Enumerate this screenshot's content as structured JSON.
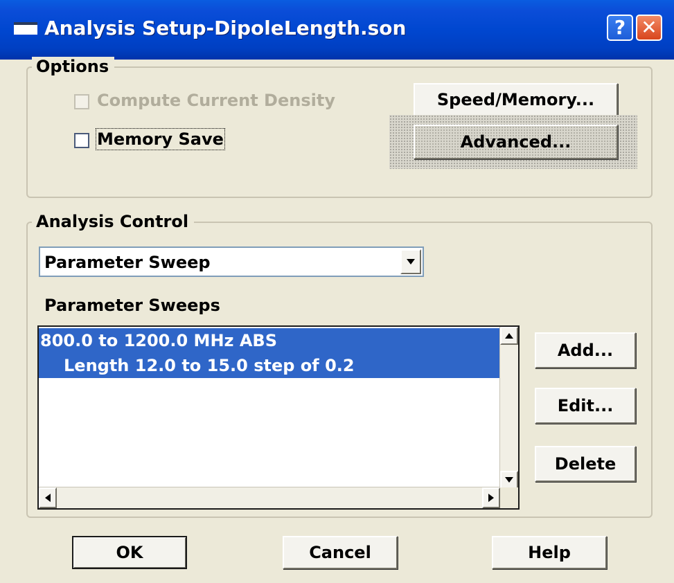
{
  "window": {
    "title": "Analysis Setup-DipoleLength.son"
  },
  "titlebar": {
    "help_glyph": "?",
    "close_glyph": "✕"
  },
  "options": {
    "group_label": "Options",
    "compute_current_density": {
      "label": "Compute Current Density",
      "checked": false,
      "enabled": false
    },
    "memory_save": {
      "label": "Memory Save",
      "checked": false,
      "enabled": true
    },
    "speed_memory_label": "Speed/Memory...",
    "advanced_label": "Advanced..."
  },
  "analysis_control": {
    "group_label": "Analysis Control",
    "mode_selected": "Parameter Sweep",
    "sweeps_label": "Parameter Sweeps",
    "sweeps": [
      {
        "text": "800.0 to 1200.0 MHz ABS",
        "selected": true
      },
      {
        "text": "Length 12.0 to 15.0 step of 0.2",
        "selected": true
      }
    ],
    "add_label": "Add...",
    "edit_label": "Edit...",
    "delete_label": "Delete"
  },
  "footer": {
    "ok_label": "OK",
    "cancel_label": "Cancel",
    "help_label": "Help"
  },
  "colors": {
    "titlebar": "#0047d0",
    "selection": "#2f66c8",
    "dialog_bg": "#ece9d8"
  }
}
